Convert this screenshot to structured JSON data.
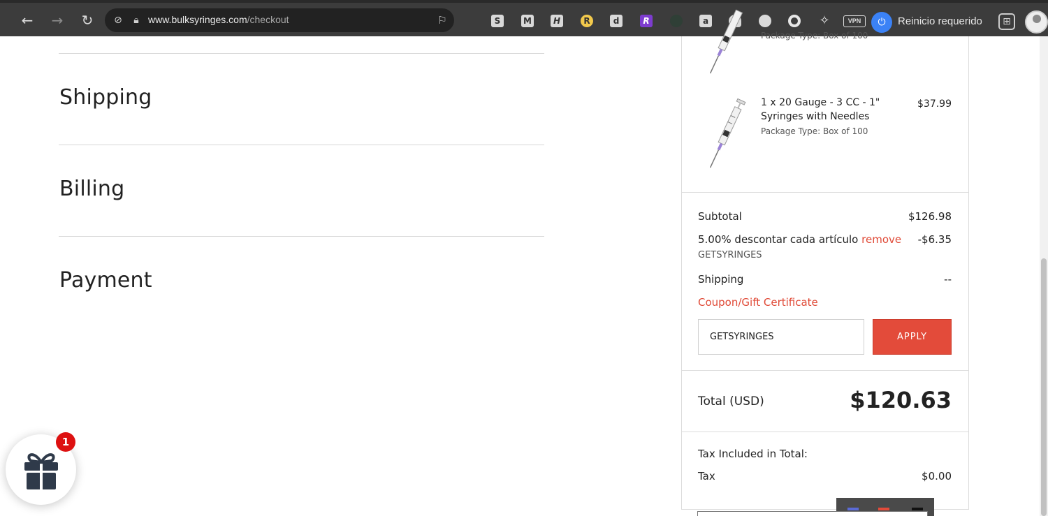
{
  "browser": {
    "url_domain": "www.bulksyringes.com",
    "url_path": "/checkout",
    "restart_label": "Reinicio requerido",
    "vpn_label": "VPN",
    "icons": {
      "back": "arrow-left-icon",
      "forward": "arrow-right-icon",
      "reload": "reload-icon",
      "site_info": "shield-off-icon",
      "lock": "lock-icon",
      "bookmark": "bookmark-icon"
    },
    "extension_letters": [
      "S",
      "M",
      "H",
      "R",
      "d",
      "R",
      "",
      "a",
      "",
      "",
      "",
      ""
    ]
  },
  "checkout_steps": [
    "Shipping",
    "Billing",
    "Payment"
  ],
  "summary": {
    "product_partial_type": "Package Type: Box of 100",
    "products": [
      {
        "name": "1 x 20 Gauge - 3 CC - 1\" Syringes with Needles",
        "package_type": "Package Type: Box of 100",
        "price": "$37.99"
      }
    ],
    "subtotal_label": "Subtotal",
    "subtotal_value": "$126.98",
    "discount_label": "5.00% descontar cada artículo",
    "discount_remove": "remove",
    "discount_value": "-$6.35",
    "discount_code": "GETSYRINGES",
    "shipping_label": "Shipping",
    "shipping_value": "--",
    "coupon_label": "Coupon/Gift Certificate",
    "coupon_value": "GETSYRINGES",
    "apply_label": "APPLY",
    "total_label": "Total (USD)",
    "total_value": "$120.63",
    "tax_included_label": "Tax Included in Total:",
    "tax_label": "Tax",
    "tax_value": "$0.00"
  },
  "gift_widget": {
    "badge_count": "1"
  },
  "colors": {
    "accent_red": "#e34b3a",
    "browser_bg": "#3c3c3c"
  }
}
